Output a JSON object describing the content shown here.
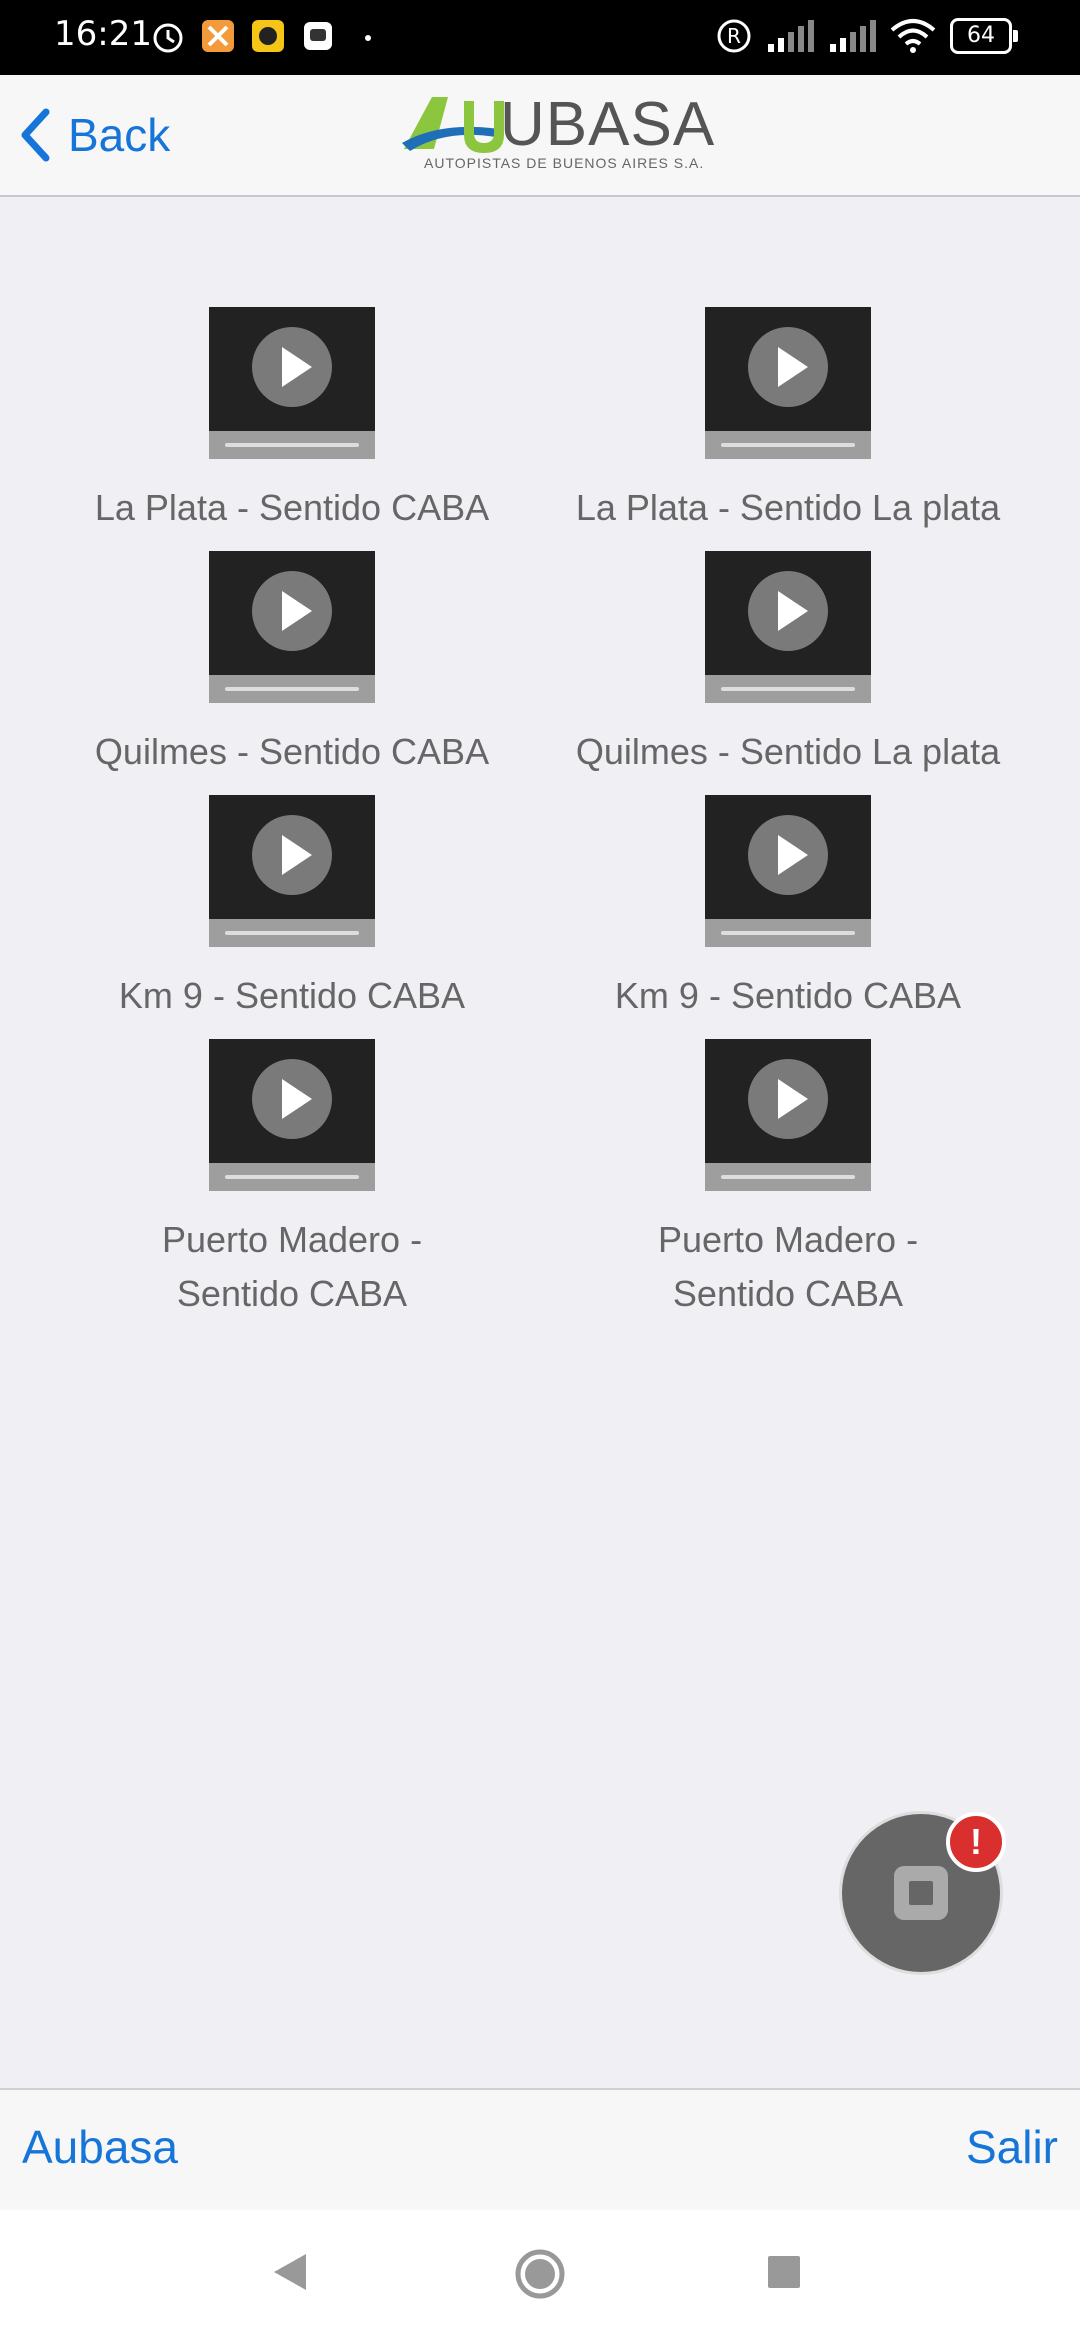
{
  "status_bar": {
    "time": "16:21",
    "battery": "64"
  },
  "header": {
    "back_label": "Back",
    "logo_text": "UBASA",
    "logo_subtitle": "AUTOPISTAS DE BUENOS AIRES S.A."
  },
  "cameras": [
    {
      "label": "La Plata - Sentido CABA"
    },
    {
      "label": "La Plata - Sentido La plata"
    },
    {
      "label": "Quilmes - Sentido CABA"
    },
    {
      "label": "Quilmes - Sentido La plata"
    },
    {
      "label": "Km 9 - Sentido CABA"
    },
    {
      "label": "Km 9 - Sentido CABA"
    },
    {
      "label": "Puerto Madero - Sentido CABA"
    },
    {
      "label": "Puerto Madero - Sentido CABA"
    }
  ],
  "fab": {
    "badge": "!"
  },
  "toolbar": {
    "left_label": "Aubasa",
    "right_label": "Salir"
  },
  "colors": {
    "accent": "#1675d9",
    "background": "#efeff4",
    "badge": "#d9302f",
    "logo_green": "#8cc63f",
    "logo_blue": "#1e6fb8"
  }
}
